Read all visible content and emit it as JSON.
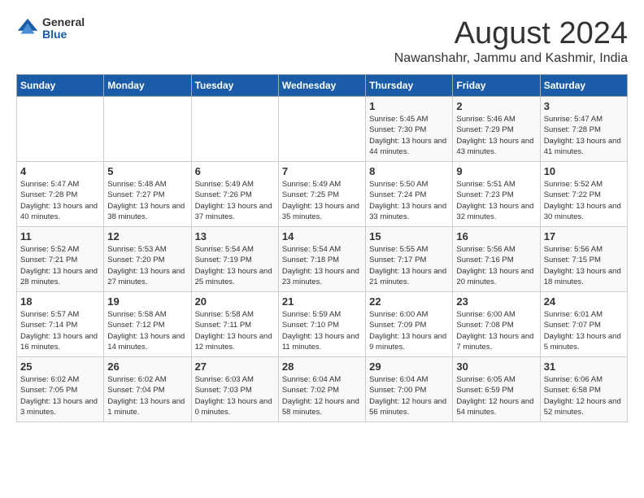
{
  "logo": {
    "general": "General",
    "blue": "Blue"
  },
  "title": {
    "month_year": "August 2024",
    "location": "Nawanshahr, Jammu and Kashmir, India"
  },
  "days_of_week": [
    "Sunday",
    "Monday",
    "Tuesday",
    "Wednesday",
    "Thursday",
    "Friday",
    "Saturday"
  ],
  "weeks": [
    [
      {
        "day": "",
        "info": ""
      },
      {
        "day": "",
        "info": ""
      },
      {
        "day": "",
        "info": ""
      },
      {
        "day": "",
        "info": ""
      },
      {
        "day": "1",
        "info": "Sunrise: 5:45 AM\nSunset: 7:30 PM\nDaylight: 13 hours\nand 44 minutes."
      },
      {
        "day": "2",
        "info": "Sunrise: 5:46 AM\nSunset: 7:29 PM\nDaylight: 13 hours\nand 43 minutes."
      },
      {
        "day": "3",
        "info": "Sunrise: 5:47 AM\nSunset: 7:28 PM\nDaylight: 13 hours\nand 41 minutes."
      }
    ],
    [
      {
        "day": "4",
        "info": "Sunrise: 5:47 AM\nSunset: 7:28 PM\nDaylight: 13 hours\nand 40 minutes."
      },
      {
        "day": "5",
        "info": "Sunrise: 5:48 AM\nSunset: 7:27 PM\nDaylight: 13 hours\nand 38 minutes."
      },
      {
        "day": "6",
        "info": "Sunrise: 5:49 AM\nSunset: 7:26 PM\nDaylight: 13 hours\nand 37 minutes."
      },
      {
        "day": "7",
        "info": "Sunrise: 5:49 AM\nSunset: 7:25 PM\nDaylight: 13 hours\nand 35 minutes."
      },
      {
        "day": "8",
        "info": "Sunrise: 5:50 AM\nSunset: 7:24 PM\nDaylight: 13 hours\nand 33 minutes."
      },
      {
        "day": "9",
        "info": "Sunrise: 5:51 AM\nSunset: 7:23 PM\nDaylight: 13 hours\nand 32 minutes."
      },
      {
        "day": "10",
        "info": "Sunrise: 5:52 AM\nSunset: 7:22 PM\nDaylight: 13 hours\nand 30 minutes."
      }
    ],
    [
      {
        "day": "11",
        "info": "Sunrise: 5:52 AM\nSunset: 7:21 PM\nDaylight: 13 hours\nand 28 minutes."
      },
      {
        "day": "12",
        "info": "Sunrise: 5:53 AM\nSunset: 7:20 PM\nDaylight: 13 hours\nand 27 minutes."
      },
      {
        "day": "13",
        "info": "Sunrise: 5:54 AM\nSunset: 7:19 PM\nDaylight: 13 hours\nand 25 minutes."
      },
      {
        "day": "14",
        "info": "Sunrise: 5:54 AM\nSunset: 7:18 PM\nDaylight: 13 hours\nand 23 minutes."
      },
      {
        "day": "15",
        "info": "Sunrise: 5:55 AM\nSunset: 7:17 PM\nDaylight: 13 hours\nand 21 minutes."
      },
      {
        "day": "16",
        "info": "Sunrise: 5:56 AM\nSunset: 7:16 PM\nDaylight: 13 hours\nand 20 minutes."
      },
      {
        "day": "17",
        "info": "Sunrise: 5:56 AM\nSunset: 7:15 PM\nDaylight: 13 hours\nand 18 minutes."
      }
    ],
    [
      {
        "day": "18",
        "info": "Sunrise: 5:57 AM\nSunset: 7:14 PM\nDaylight: 13 hours\nand 16 minutes."
      },
      {
        "day": "19",
        "info": "Sunrise: 5:58 AM\nSunset: 7:12 PM\nDaylight: 13 hours\nand 14 minutes."
      },
      {
        "day": "20",
        "info": "Sunrise: 5:58 AM\nSunset: 7:11 PM\nDaylight: 13 hours\nand 12 minutes."
      },
      {
        "day": "21",
        "info": "Sunrise: 5:59 AM\nSunset: 7:10 PM\nDaylight: 13 hours\nand 11 minutes."
      },
      {
        "day": "22",
        "info": "Sunrise: 6:00 AM\nSunset: 7:09 PM\nDaylight: 13 hours\nand 9 minutes."
      },
      {
        "day": "23",
        "info": "Sunrise: 6:00 AM\nSunset: 7:08 PM\nDaylight: 13 hours\nand 7 minutes."
      },
      {
        "day": "24",
        "info": "Sunrise: 6:01 AM\nSunset: 7:07 PM\nDaylight: 13 hours\nand 5 minutes."
      }
    ],
    [
      {
        "day": "25",
        "info": "Sunrise: 6:02 AM\nSunset: 7:05 PM\nDaylight: 13 hours\nand 3 minutes."
      },
      {
        "day": "26",
        "info": "Sunrise: 6:02 AM\nSunset: 7:04 PM\nDaylight: 13 hours\nand 1 minute."
      },
      {
        "day": "27",
        "info": "Sunrise: 6:03 AM\nSunset: 7:03 PM\nDaylight: 13 hours\nand 0 minutes."
      },
      {
        "day": "28",
        "info": "Sunrise: 6:04 AM\nSunset: 7:02 PM\nDaylight: 12 hours\nand 58 minutes."
      },
      {
        "day": "29",
        "info": "Sunrise: 6:04 AM\nSunset: 7:00 PM\nDaylight: 12 hours\nand 56 minutes."
      },
      {
        "day": "30",
        "info": "Sunrise: 6:05 AM\nSunset: 6:59 PM\nDaylight: 12 hours\nand 54 minutes."
      },
      {
        "day": "31",
        "info": "Sunrise: 6:06 AM\nSunset: 6:58 PM\nDaylight: 12 hours\nand 52 minutes."
      }
    ]
  ]
}
